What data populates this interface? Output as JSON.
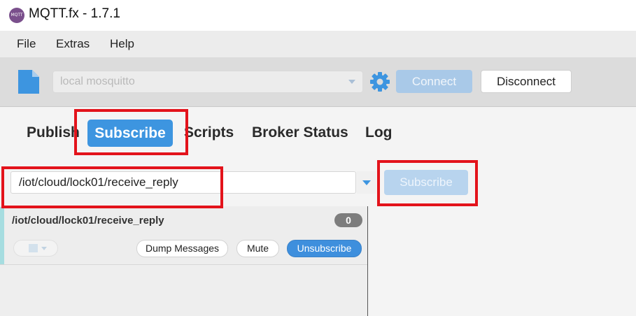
{
  "window": {
    "title": "MQTT.fx - 1.7.1",
    "app_icon_text": "MQTT fx"
  },
  "menu": [
    "File",
    "Extras",
    "Help"
  ],
  "toolbar": {
    "profile_value": "local mosquitto",
    "connect_label": "Connect",
    "disconnect_label": "Disconnect"
  },
  "tabs": [
    "Publish",
    "Subscribe",
    "Scripts",
    "Broker Status",
    "Log"
  ],
  "active_tab": "Subscribe",
  "subscribe": {
    "topic_value": "/iot/cloud/lock01/receive_reply",
    "button_label": "Subscribe"
  },
  "subscription": {
    "topic": "/iot/cloud/lock01/receive_reply",
    "count": "0",
    "dump_label": "Dump Messages",
    "mute_label": "Mute",
    "unsubscribe_label": "Unsubscribe"
  },
  "colors": {
    "accent": "#3d95e0",
    "highlight_box": "#e3131b",
    "disabled_button": "#a9c9e8"
  },
  "icons": [
    "app-logo-icon",
    "document-icon",
    "gear-icon",
    "dropdown-arrow-icon"
  ]
}
